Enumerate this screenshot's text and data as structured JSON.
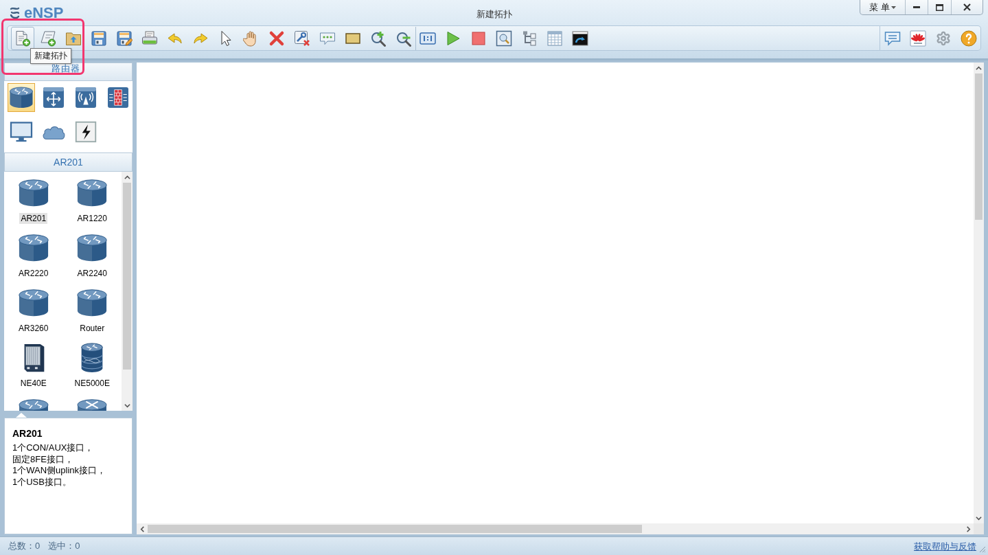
{
  "window": {
    "logo": "eNSP",
    "title": "新建拓扑",
    "menu": "菜 单"
  },
  "toolbar": {
    "groups": [
      {
        "buttons": [
          {
            "kind": "new-topology",
            "hovered": true
          },
          {
            "kind": "new-example",
            "hovered": false
          },
          {
            "kind": "open",
            "hovered": false
          },
          {
            "kind": "save",
            "hovered": false
          },
          {
            "kind": "save-as",
            "hovered": false
          },
          {
            "kind": "print",
            "hovered": false
          },
          {
            "kind": "undo",
            "hovered": false
          },
          {
            "kind": "redo",
            "hovered": false
          },
          {
            "kind": "select",
            "hovered": false
          },
          {
            "kind": "pan",
            "hovered": false
          },
          {
            "kind": "delete",
            "hovered": false
          },
          {
            "kind": "delete-links",
            "hovered": false
          },
          {
            "kind": "text",
            "hovered": false
          },
          {
            "kind": "palette",
            "hovered": false
          },
          {
            "kind": "zoom-in",
            "hovered": false
          },
          {
            "kind": "zoom-out",
            "hovered": false
          }
        ]
      },
      {
        "buttons": [
          {
            "kind": "actual-size",
            "hovered": false
          },
          {
            "kind": "start",
            "hovered": false
          },
          {
            "kind": "stop",
            "hovered": false
          },
          {
            "kind": "capture",
            "hovered": false
          },
          {
            "kind": "topology",
            "hovered": false
          },
          {
            "kind": "grid",
            "hovered": false
          },
          {
            "kind": "console",
            "hovered": false
          }
        ]
      }
    ],
    "right_buttons": [
      {
        "kind": "feedback"
      },
      {
        "kind": "vendor"
      },
      {
        "kind": "settings"
      },
      {
        "kind": "help"
      }
    ]
  },
  "tooltip": {
    "text": "新建拓扑"
  },
  "device_panel": {
    "category_title": "路由器",
    "categories": [
      {
        "kind": "router",
        "selected": true
      },
      {
        "kind": "switch",
        "selected": false
      },
      {
        "kind": "wireless",
        "selected": false
      },
      {
        "kind": "firewall",
        "selected": false
      },
      {
        "kind": "pc",
        "selected": false
      },
      {
        "kind": "cloud",
        "selected": false
      },
      {
        "kind": "link",
        "selected": false
      }
    ],
    "series_title": "AR201",
    "devices": [
      {
        "kind": "router",
        "label": "AR201",
        "selected": true
      },
      {
        "kind": "router",
        "label": "AR1220",
        "selected": false
      },
      {
        "kind": "router",
        "label": "AR2220",
        "selected": false
      },
      {
        "kind": "router",
        "label": "AR2240",
        "selected": false
      },
      {
        "kind": "router",
        "label": "AR3260",
        "selected": false
      },
      {
        "kind": "router",
        "label": "Router",
        "selected": false
      },
      {
        "kind": "chassis",
        "label": "NE40E",
        "selected": false
      },
      {
        "kind": "tall-router",
        "label": "NE5000E",
        "selected": false
      },
      {
        "kind": "router"
      },
      {
        "kind": "cross-router"
      }
    ]
  },
  "description": {
    "title": "AR201",
    "lines": [
      "1个CON/AUX接口，",
      "固定8FE接口，",
      "1个WAN侧uplink接口，",
      "1个USB接口。"
    ]
  },
  "status_bar": {
    "counts": [
      "总数：0",
      "选中：0"
    ],
    "help_link": "获取帮助与反馈"
  }
}
